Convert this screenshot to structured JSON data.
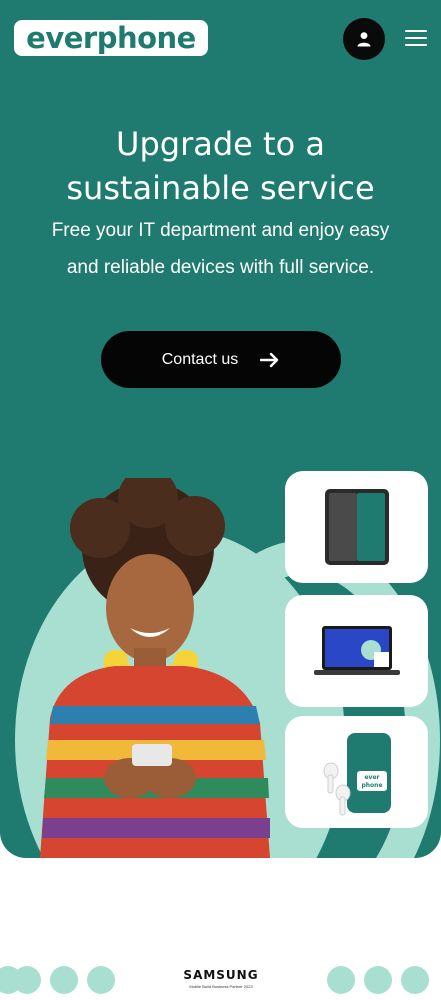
{
  "header": {
    "logo_text": "everphone",
    "account_icon": "user-icon",
    "menu_icon": "hamburger-menu-icon"
  },
  "hero": {
    "title_line1": "Upgrade to a",
    "title_line2": "sustainable service",
    "subtitle_line1": "Free your IT department and enjoy easy",
    "subtitle_line2": "and reliable devices with full service.",
    "cta_label": "Contact us",
    "cta_icon": "arrow-right-icon"
  },
  "device_cards": [
    {
      "icon": "smartphone-icon"
    },
    {
      "icon": "laptop-icon"
    },
    {
      "icon": "earbuds-and-phone-case-icon",
      "case_text": "everphone"
    }
  ],
  "footer": {
    "partner_brand": "SAMSUNG",
    "partner_caption": "Mobile Build Business Partner 2023"
  },
  "colors": {
    "brand_teal": "#1f7b6f",
    "mint": "#a8dfd1",
    "cta_black": "#050505"
  }
}
